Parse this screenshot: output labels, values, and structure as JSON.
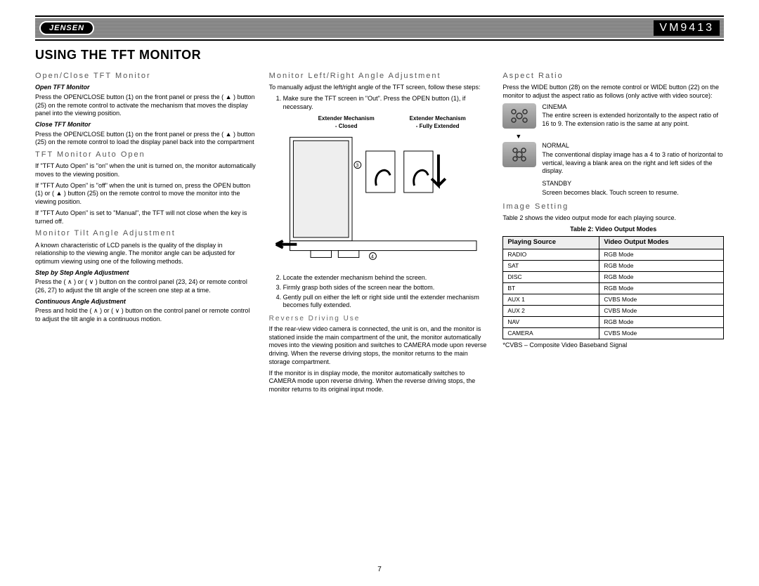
{
  "header": {
    "logo": "JENSEN",
    "model": "VM9413"
  },
  "title": "USING THE TFT MONITOR",
  "left": {
    "h2a": "Open/Close TFT Monitor",
    "h3a": "Open TFT Monitor",
    "p1": "Press the OPEN/CLOSE button (1) on the front panel or press the ( ▲ ) button (25) on the remote control to activate the mechanism that moves the display panel into the viewing position.",
    "h3b": "Close TFT Monitor",
    "p2": "Press the OPEN/CLOSE button (1) on the front panel or press the ( ▲ ) button (25) on the remote control to load the display panel back into the compartment",
    "h2b": "TFT Monitor Auto Open",
    "p3": "If \"TFT Auto Open\" is \"on\" when the unit is turned on, the monitor automatically moves to the viewing position.",
    "p4": "If \"TFT Auto Open\" is \"off\" when the unit is turned on, press the OPEN button (1) or ( ▲ ) button (25) on the remote control to move the monitor into the viewing position.",
    "p5": "If \"TFT Auto Open\" is set to \"Manual\", the TFT will not close when the key is turned off.",
    "h2c": "Monitor Tilt Angle Adjustment",
    "p6": "A known characteristic of LCD panels is the quality of the display in relationship to the viewing angle. The monitor angle can be adjusted for optimum viewing using one of the following methods.",
    "h3c": "Step by Step Angle Adjustment",
    "p7": "Press the ( ∧ ) or ( ∨ ) button on the control panel (23, 24) or remote control (26, 27) to adjust the tilt angle of the screen one step at a time.",
    "h3d": "Continuous Angle Adjustment",
    "p8": "Press and hold the ( ∧ ) or ( ∨ ) button on the control panel or remote control to adjust the tilt angle in a continuous motion."
  },
  "mid": {
    "h2a": "Monitor Left/Right Angle Adjustment",
    "intro": "To manually adjust the left/right angle of the TFT screen, follow these steps:",
    "step1": "Make sure the TFT screen in \"Out\". Press the OPEN button (1), if necessary.",
    "figL1": "Extender Mechanism",
    "figL2": "- Closed",
    "figR1": "Extender Mechanism",
    "figR2": "- Fully Extended",
    "step2": "Locate the extender mechanism behind the screen.",
    "step3": "Firmly grasp both sides of the screen near the bottom.",
    "step4": "Gently pull on either the left or right side until the extender mechanism becomes fully extended.",
    "h4a": "Reverse Driving Use",
    "rev1": "If the rear-view video camera is connected, the unit is on, and the monitor is stationed inside the main compartment of the unit, the monitor automatically moves into the viewing position and switches to CAMERA mode upon reverse driving. When the reverse driving stops, the monitor returns to the main storage compartment.",
    "rev2": "If the monitor is in display mode, the monitor automatically switches to CAMERA mode upon reverse driving. When the reverse driving stops, the monitor returns to its original input mode."
  },
  "right": {
    "h2a": "Aspect Ratio",
    "intro": "Press the WIDE button (28) on the remote control or WIDE button (22) on the monitor to adjust the aspect ratio as follows (only active with video source):",
    "cinema_t": "CINEMA",
    "cinema_d": "The entire screen is extended horizontally to the aspect ratio of 16 to 9. The extension ratio is the same at any point.",
    "normal_t": "NORMAL",
    "normal_d": "The conventional display image has a 4 to 3 ratio of horizontal to vertical, leaving a blank area on the right and left sides of the display.",
    "standby_t": "STANDBY",
    "standby_d": "Screen becomes black. Touch screen to resume.",
    "h2b": "Image Setting",
    "img_p": "Table 2 shows the video output mode for each playing source.",
    "tcap": "Table 2: Video Output Modes",
    "th1": "Playing Source",
    "th2": "Video Output Modes",
    "rows": [
      [
        "RADIO",
        "RGB Mode"
      ],
      [
        "SAT",
        "RGB Mode"
      ],
      [
        "DISC",
        "RGB Mode"
      ],
      [
        "BT",
        "RGB Mode"
      ],
      [
        "AUX 1",
        "CVBS Mode"
      ],
      [
        "AUX 2",
        "CVBS Mode"
      ],
      [
        "NAV",
        "RGB Mode"
      ],
      [
        "CAMERA",
        "CVBS Mode"
      ]
    ],
    "foot": "*CVBS – Composite Video Baseband Signal"
  },
  "pageno": "7"
}
